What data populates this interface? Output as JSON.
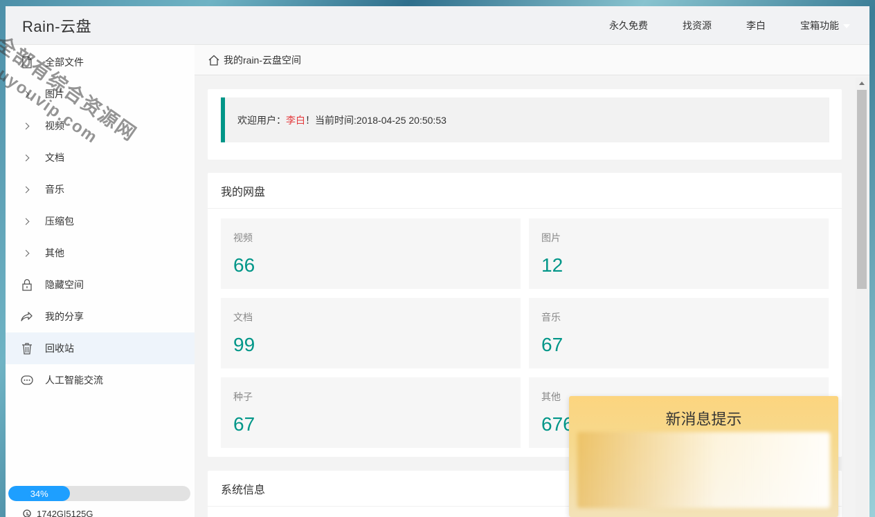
{
  "header": {
    "logo": "Rain-云盘",
    "nav": [
      "永久免费",
      "找资源",
      "李白",
      "宝箱功能"
    ]
  },
  "sidebar": {
    "items": [
      {
        "label": "全部文件",
        "icon": "file-icon"
      },
      {
        "label": "图片",
        "icon": "chevron-right-icon"
      },
      {
        "label": "视频",
        "icon": "chevron-right-icon"
      },
      {
        "label": "文档",
        "icon": "chevron-right-icon"
      },
      {
        "label": "音乐",
        "icon": "chevron-right-icon"
      },
      {
        "label": "压缩包",
        "icon": "chevron-right-icon"
      },
      {
        "label": "其他",
        "icon": "chevron-right-icon"
      },
      {
        "label": "隐藏空间",
        "icon": "lock-icon"
      },
      {
        "label": "我的分享",
        "icon": "share-icon"
      },
      {
        "label": "回收站",
        "icon": "trash-icon"
      },
      {
        "label": "人工智能交流",
        "icon": "chat-icon"
      }
    ],
    "usage_percent": "34%",
    "usage_value": 0.34,
    "storage": "1742G|5125G"
  },
  "breadcrumb": "我的rain-云盘空间",
  "welcome": {
    "prefix": "欢迎用户：",
    "user": "李白",
    "suffix": "！当前时间:2018-04-25 20:50:53"
  },
  "disk": {
    "title": "我的网盘",
    "stats": [
      {
        "label": "视频",
        "value": "66"
      },
      {
        "label": "图片",
        "value": "12"
      },
      {
        "label": "文档",
        "value": "99"
      },
      {
        "label": "音乐",
        "value": "67"
      },
      {
        "label": "种子",
        "value": "67"
      },
      {
        "label": "其他",
        "value": "676"
      }
    ]
  },
  "system": {
    "title": "系统信息"
  },
  "popup": {
    "title": "新消息提示"
  },
  "watermark": {
    "line1": "全部有综合资源网",
    "line2": "douyouvip.com"
  },
  "colors": {
    "accent": "#009688",
    "progress": "#1e9fff",
    "user": "#e4393c"
  }
}
